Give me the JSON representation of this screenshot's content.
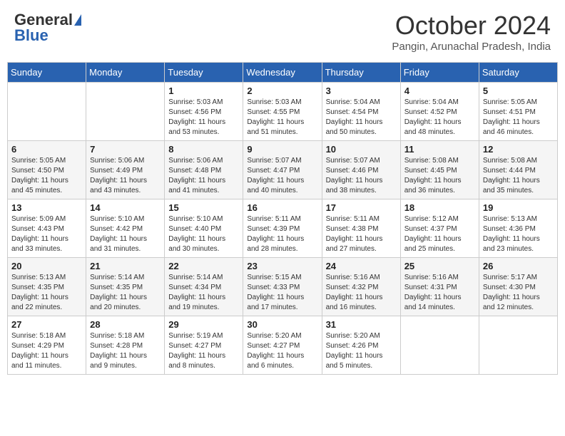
{
  "logo": {
    "general": "General",
    "blue": "Blue"
  },
  "header": {
    "month": "October 2024",
    "location": "Pangin, Arunachal Pradesh, India"
  },
  "days_of_week": [
    "Sunday",
    "Monday",
    "Tuesday",
    "Wednesday",
    "Thursday",
    "Friday",
    "Saturday"
  ],
  "weeks": [
    [
      {
        "day": "",
        "info": ""
      },
      {
        "day": "",
        "info": ""
      },
      {
        "day": "1",
        "info": "Sunrise: 5:03 AM\nSunset: 4:56 PM\nDaylight: 11 hours and 53 minutes."
      },
      {
        "day": "2",
        "info": "Sunrise: 5:03 AM\nSunset: 4:55 PM\nDaylight: 11 hours and 51 minutes."
      },
      {
        "day": "3",
        "info": "Sunrise: 5:04 AM\nSunset: 4:54 PM\nDaylight: 11 hours and 50 minutes."
      },
      {
        "day": "4",
        "info": "Sunrise: 5:04 AM\nSunset: 4:52 PM\nDaylight: 11 hours and 48 minutes."
      },
      {
        "day": "5",
        "info": "Sunrise: 5:05 AM\nSunset: 4:51 PM\nDaylight: 11 hours and 46 minutes."
      }
    ],
    [
      {
        "day": "6",
        "info": "Sunrise: 5:05 AM\nSunset: 4:50 PM\nDaylight: 11 hours and 45 minutes."
      },
      {
        "day": "7",
        "info": "Sunrise: 5:06 AM\nSunset: 4:49 PM\nDaylight: 11 hours and 43 minutes."
      },
      {
        "day": "8",
        "info": "Sunrise: 5:06 AM\nSunset: 4:48 PM\nDaylight: 11 hours and 41 minutes."
      },
      {
        "day": "9",
        "info": "Sunrise: 5:07 AM\nSunset: 4:47 PM\nDaylight: 11 hours and 40 minutes."
      },
      {
        "day": "10",
        "info": "Sunrise: 5:07 AM\nSunset: 4:46 PM\nDaylight: 11 hours and 38 minutes."
      },
      {
        "day": "11",
        "info": "Sunrise: 5:08 AM\nSunset: 4:45 PM\nDaylight: 11 hours and 36 minutes."
      },
      {
        "day": "12",
        "info": "Sunrise: 5:08 AM\nSunset: 4:44 PM\nDaylight: 11 hours and 35 minutes."
      }
    ],
    [
      {
        "day": "13",
        "info": "Sunrise: 5:09 AM\nSunset: 4:43 PM\nDaylight: 11 hours and 33 minutes."
      },
      {
        "day": "14",
        "info": "Sunrise: 5:10 AM\nSunset: 4:42 PM\nDaylight: 11 hours and 31 minutes."
      },
      {
        "day": "15",
        "info": "Sunrise: 5:10 AM\nSunset: 4:40 PM\nDaylight: 11 hours and 30 minutes."
      },
      {
        "day": "16",
        "info": "Sunrise: 5:11 AM\nSunset: 4:39 PM\nDaylight: 11 hours and 28 minutes."
      },
      {
        "day": "17",
        "info": "Sunrise: 5:11 AM\nSunset: 4:38 PM\nDaylight: 11 hours and 27 minutes."
      },
      {
        "day": "18",
        "info": "Sunrise: 5:12 AM\nSunset: 4:37 PM\nDaylight: 11 hours and 25 minutes."
      },
      {
        "day": "19",
        "info": "Sunrise: 5:13 AM\nSunset: 4:36 PM\nDaylight: 11 hours and 23 minutes."
      }
    ],
    [
      {
        "day": "20",
        "info": "Sunrise: 5:13 AM\nSunset: 4:35 PM\nDaylight: 11 hours and 22 minutes."
      },
      {
        "day": "21",
        "info": "Sunrise: 5:14 AM\nSunset: 4:35 PM\nDaylight: 11 hours and 20 minutes."
      },
      {
        "day": "22",
        "info": "Sunrise: 5:14 AM\nSunset: 4:34 PM\nDaylight: 11 hours and 19 minutes."
      },
      {
        "day": "23",
        "info": "Sunrise: 5:15 AM\nSunset: 4:33 PM\nDaylight: 11 hours and 17 minutes."
      },
      {
        "day": "24",
        "info": "Sunrise: 5:16 AM\nSunset: 4:32 PM\nDaylight: 11 hours and 16 minutes."
      },
      {
        "day": "25",
        "info": "Sunrise: 5:16 AM\nSunset: 4:31 PM\nDaylight: 11 hours and 14 minutes."
      },
      {
        "day": "26",
        "info": "Sunrise: 5:17 AM\nSunset: 4:30 PM\nDaylight: 11 hours and 12 minutes."
      }
    ],
    [
      {
        "day": "27",
        "info": "Sunrise: 5:18 AM\nSunset: 4:29 PM\nDaylight: 11 hours and 11 minutes."
      },
      {
        "day": "28",
        "info": "Sunrise: 5:18 AM\nSunset: 4:28 PM\nDaylight: 11 hours and 9 minutes."
      },
      {
        "day": "29",
        "info": "Sunrise: 5:19 AM\nSunset: 4:27 PM\nDaylight: 11 hours and 8 minutes."
      },
      {
        "day": "30",
        "info": "Sunrise: 5:20 AM\nSunset: 4:27 PM\nDaylight: 11 hours and 6 minutes."
      },
      {
        "day": "31",
        "info": "Sunrise: 5:20 AM\nSunset: 4:26 PM\nDaylight: 11 hours and 5 minutes."
      },
      {
        "day": "",
        "info": ""
      },
      {
        "day": "",
        "info": ""
      }
    ]
  ]
}
